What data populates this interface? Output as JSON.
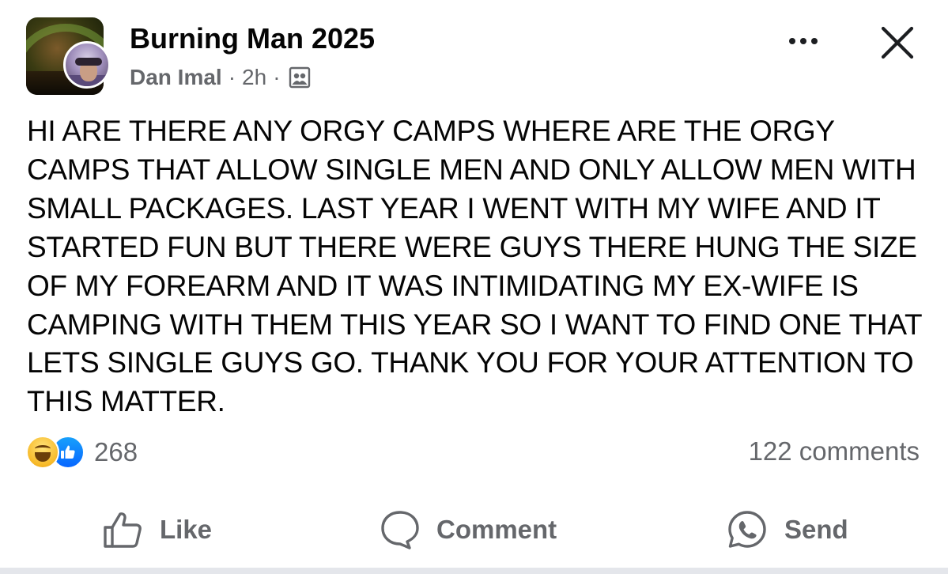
{
  "post": {
    "group_name": "Burning Man 2025",
    "author": "Dan Imal",
    "separator": "·",
    "time": "2h",
    "visibility_icon": "group-members-icon",
    "text": "HI ARE THERE ANY ORGY CAMPS WHERE ARE THE ORGY CAMPS THAT ALLOW SINGLE MEN AND ONLY ALLOW MEN WITH SMALL PACKAGES. LAST YEAR I WENT WITH MY WIFE AND IT STARTED FUN BUT THERE WERE GUYS THERE HUNG THE SIZE OF MY FOREARM AND IT WAS INTIMIDATING MY EX-WIFE IS CAMPING WITH THEM THIS YEAR SO I WANT TO FIND ONE THAT LETS SINGLE GUYS GO. THANK YOU FOR YOUR ATTENTION TO THIS MATTER."
  },
  "header_icons": {
    "more": "more-icon",
    "close": "close-icon"
  },
  "stats": {
    "reactions": [
      "haha",
      "like"
    ],
    "reaction_count": "268",
    "comments": "122 comments"
  },
  "actions": {
    "like": "Like",
    "comment": "Comment",
    "send": "Send"
  },
  "colors": {
    "text": "#050505",
    "secondary": "#65676b",
    "like_blue": "#0766ff",
    "haha_yellow": "#f7b928"
  }
}
